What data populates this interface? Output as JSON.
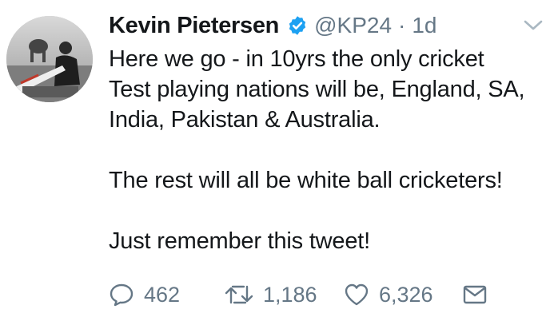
{
  "user": {
    "name": "Kevin Pietersen",
    "handle": "@KP24",
    "separator": "·",
    "time": "1d",
    "verified": true
  },
  "tweet": {
    "paragraphs": [
      [
        "Here we go - in 10yrs the only cricket",
        "Test playing nations will be, England, SA,",
        "India, Pakistan & Australia."
      ],
      [
        "The rest will all be white ball cricketers!"
      ],
      [
        "Just remember this tweet!"
      ]
    ]
  },
  "actions": {
    "reply_count": "462",
    "retweet_count": "1,186",
    "like_count": "6,326"
  },
  "icons": {
    "verified": "verified-badge-icon",
    "caret": "chevron-down-icon",
    "reply": "reply-icon",
    "retweet": "retweet-icon",
    "like": "heart-icon",
    "dm": "envelope-icon"
  },
  "colors": {
    "text": "#14171a",
    "secondary": "#657786",
    "verified": "#1da1f2",
    "caret": "#aab8c2"
  }
}
